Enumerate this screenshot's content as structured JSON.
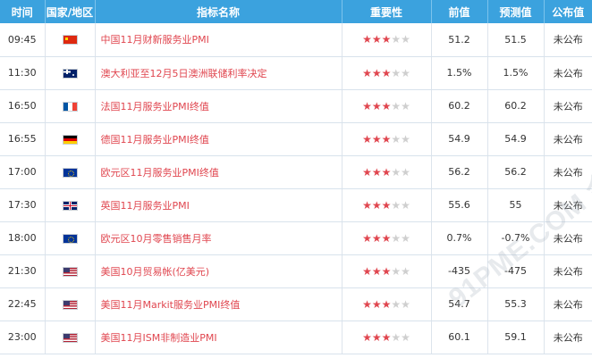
{
  "colors": {
    "header_bg": "#3ba2de",
    "indicator_text": "#e0464f",
    "star_on": "#e0464f",
    "star_off": "#cfcfcf"
  },
  "columns": [
    "时间",
    "国家/地区",
    "指标名称",
    "重要性",
    "前值",
    "预测值",
    "公布值"
  ],
  "rows": [
    {
      "time": "09:45",
      "flag": "china-flag-icon",
      "indicator": "中国11月财新服务业PMI",
      "importance": 3,
      "previous": "51.2",
      "forecast": "51.5",
      "actual": "未公布"
    },
    {
      "time": "11:30",
      "flag": "australia-flag-icon",
      "indicator": "澳大利亚至12月5日澳洲联储利率决定",
      "importance": 3,
      "previous": "1.5%",
      "forecast": "1.5%",
      "actual": "未公布"
    },
    {
      "time": "16:50",
      "flag": "france-flag-icon",
      "indicator": "法国11月服务业PMI终值",
      "importance": 3,
      "previous": "60.2",
      "forecast": "60.2",
      "actual": "未公布"
    },
    {
      "time": "16:55",
      "flag": "germany-flag-icon",
      "indicator": "德国11月服务业PMI终值",
      "importance": 3,
      "previous": "54.9",
      "forecast": "54.9",
      "actual": "未公布"
    },
    {
      "time": "17:00",
      "flag": "eu-flag-icon",
      "indicator": "欧元区11月服务业PMI终值",
      "importance": 3,
      "previous": "56.2",
      "forecast": "56.2",
      "actual": "未公布"
    },
    {
      "time": "17:30",
      "flag": "uk-flag-icon",
      "indicator": "英国11月服务业PMI",
      "importance": 3,
      "previous": "55.6",
      "forecast": "55",
      "actual": "未公布"
    },
    {
      "time": "18:00",
      "flag": "eu-flag-icon",
      "indicator": "欧元区10月零售销售月率",
      "importance": 3,
      "previous": "0.7%",
      "forecast": "-0.7%",
      "actual": "未公布"
    },
    {
      "time": "21:30",
      "flag": "usa-flag-icon",
      "indicator": "美国10月贸易帐(亿美元)",
      "importance": 3,
      "previous": "-435",
      "forecast": "-475",
      "actual": "未公布"
    },
    {
      "time": "22:45",
      "flag": "usa-flag-icon",
      "indicator": "美国11月Markit服务业PMI终值",
      "importance": 3,
      "previous": "54.7",
      "forecast": "55.3",
      "actual": "未公布"
    },
    {
      "time": "23:00",
      "flag": "usa-flag-icon",
      "indicator": "美国11月ISM非制造业PMI",
      "importance": 3,
      "previous": "60.1",
      "forecast": "59.1",
      "actual": "未公布"
    }
  ],
  "max_importance": 5,
  "watermark": "91PME.COM 金盈汇金"
}
